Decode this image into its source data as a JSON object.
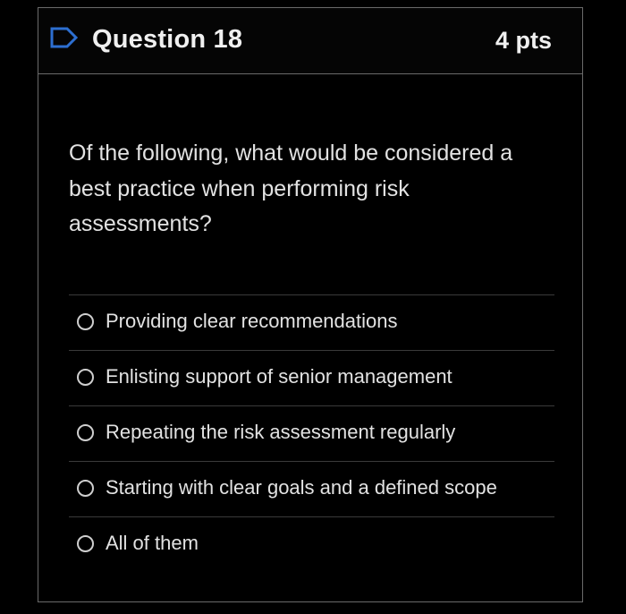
{
  "question": {
    "title": "Question 18",
    "points": "4 pts",
    "flag_icon": "flag-outline-icon",
    "text": "Of the following, what would be considered a best practice when performing risk assessments?"
  },
  "options": [
    {
      "label": "Providing clear recommendations",
      "selected": false
    },
    {
      "label": "Enlisting support of senior management",
      "selected": false
    },
    {
      "label": "Repeating the risk assessment regularly",
      "selected": false
    },
    {
      "label": "Starting with clear goals and a defined scope",
      "selected": false
    },
    {
      "label": "All of them",
      "selected": false
    }
  ],
  "colors": {
    "background": "#000000",
    "border": "#6a6a6a",
    "flag_icon": "#2d6fd1",
    "text": "#e2e2e2"
  }
}
